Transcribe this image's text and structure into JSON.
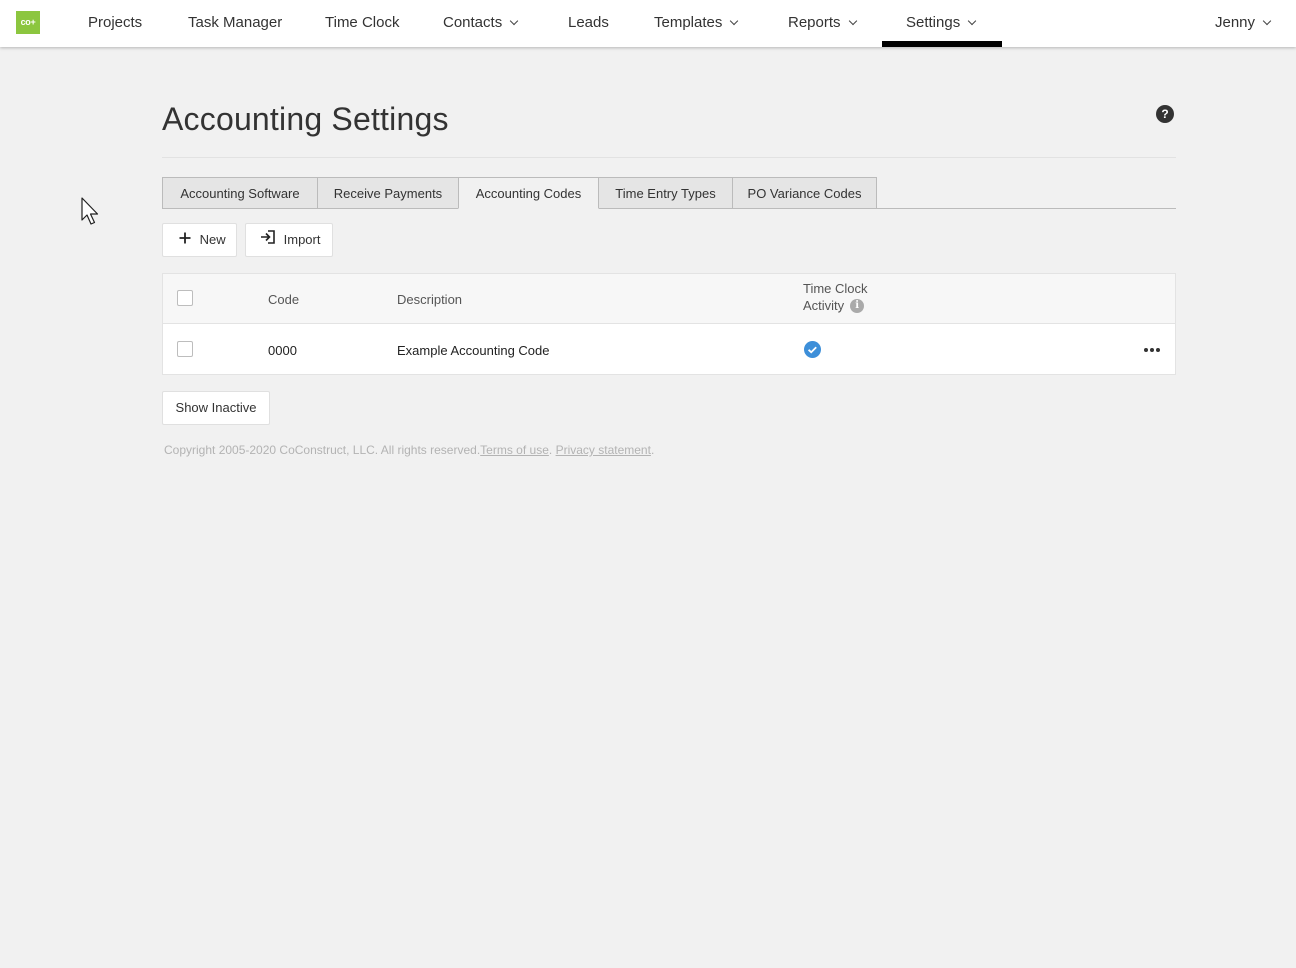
{
  "brand": {
    "logo_text": "co+",
    "logo_color": "#8cc63f"
  },
  "nav": {
    "items": [
      {
        "label": "Projects"
      },
      {
        "label": "Task Manager"
      },
      {
        "label": "Time Clock"
      },
      {
        "label": "Contacts"
      },
      {
        "label": "Leads"
      },
      {
        "label": "Templates"
      },
      {
        "label": "Reports"
      },
      {
        "label": "Settings"
      }
    ],
    "active": "Settings",
    "user": "Jenny"
  },
  "page": {
    "title": "Accounting Settings",
    "help_icon": "question-circle-icon"
  },
  "tabs": [
    {
      "label": "Accounting Software"
    },
    {
      "label": "Receive Payments"
    },
    {
      "label": "Accounting Codes"
    },
    {
      "label": "Time Entry Types"
    },
    {
      "label": "PO Variance Codes"
    }
  ],
  "active_tab": "Accounting Codes",
  "toolbar": {
    "new_label": "New",
    "import_label": "Import"
  },
  "table": {
    "columns": {
      "code": "Code",
      "description": "Description",
      "time_clock_line1": "Time Clock",
      "time_clock_line2": "Activity"
    },
    "rows": [
      {
        "code": "0000",
        "description": "Example Accounting Code",
        "time_clock_activity": true
      }
    ],
    "check_color": "#3d8fd9"
  },
  "show_inactive_label": "Show Inactive",
  "footer": {
    "copyright": "Copyright 2005-2020 CoConstruct, LLC. All rights reserved.",
    "terms": "Terms of use",
    "separator": ".",
    "privacy": "Privacy statement",
    "end": "."
  }
}
